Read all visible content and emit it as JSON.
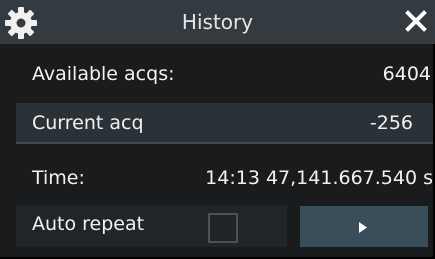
{
  "window": {
    "title": "History",
    "settings_icon": "gear-icon",
    "close_icon": "close-icon"
  },
  "available": {
    "label": "Available acqs:",
    "value": "6404"
  },
  "current": {
    "label": "Current acq",
    "value": "-256"
  },
  "time": {
    "label": "Time:",
    "value": "14:13 47,141.667.540 s"
  },
  "auto_repeat": {
    "label": "Auto repeat",
    "checked": false
  },
  "play": {
    "icon": "play-icon"
  },
  "colors": {
    "background": "#1a1b1d",
    "titlebar": "#333b41",
    "field": "#2b3237",
    "button": "#3a4d5a",
    "text": "#f2f2f2"
  }
}
